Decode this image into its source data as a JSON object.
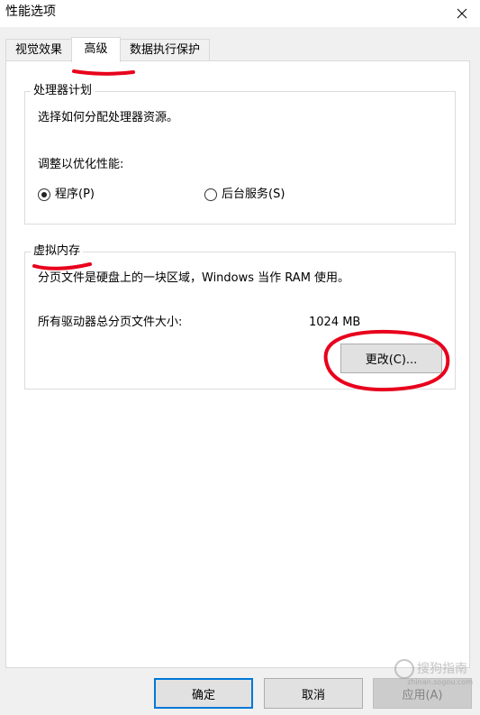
{
  "window": {
    "title": "性能选项"
  },
  "tabs": [
    {
      "label": "视觉效果",
      "active": false
    },
    {
      "label": "高级",
      "active": true
    },
    {
      "label": "数据执行保护",
      "active": false
    }
  ],
  "processor_group": {
    "title": "处理器计划",
    "description": "选择如何分配处理器资源。",
    "adjust_label": "调整以优化性能:",
    "options": [
      {
        "label": "程序(P)",
        "selected": true
      },
      {
        "label": "后台服务(S)",
        "selected": false
      }
    ]
  },
  "virtual_memory_group": {
    "title": "虚拟内存",
    "description": "分页文件是硬盘上的一块区域，Windows 当作 RAM 使用。",
    "total_label": "所有驱动器总分页文件大小:",
    "total_value": "1024 MB",
    "change_button": "更改(C)..."
  },
  "footer": {
    "ok": "确定",
    "cancel": "取消",
    "apply": "应用(A)"
  },
  "watermark": {
    "text": "搜狗指南",
    "sub": "zhinan.sogou.com"
  },
  "colors": {
    "annotation": "#e8001c",
    "default_button_border": "#0078d7",
    "panel_background": "#ffffff",
    "dialog_background": "#f0f0f0"
  }
}
